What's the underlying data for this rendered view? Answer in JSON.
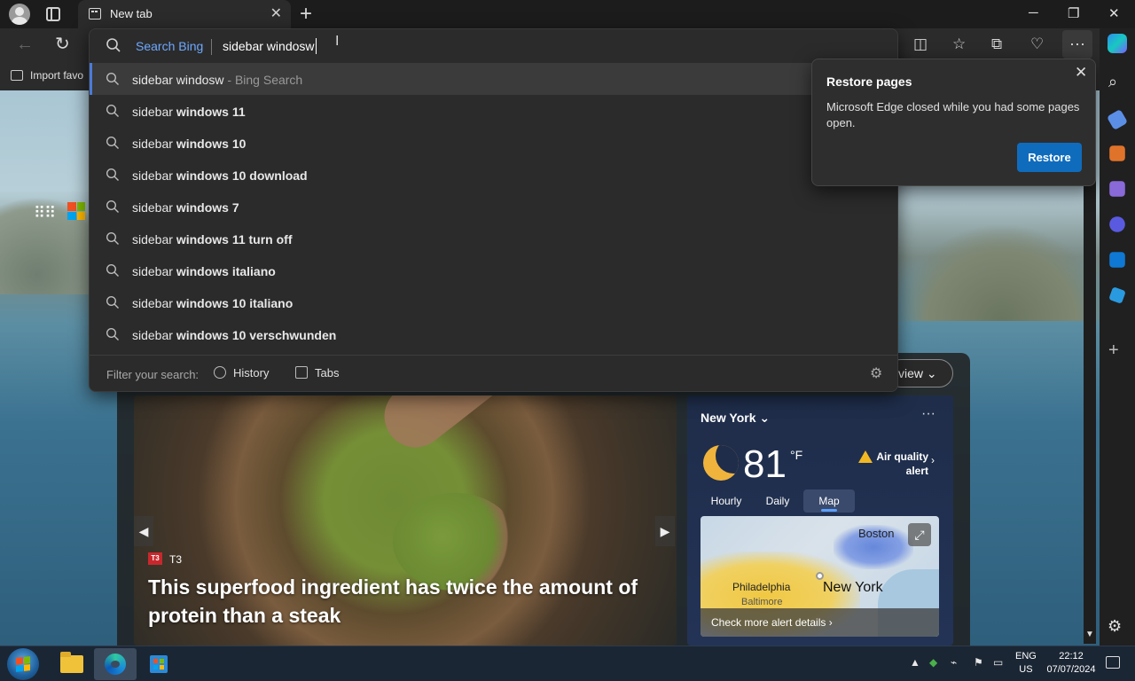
{
  "browser": {
    "tab_title": "New tab",
    "favorites": {
      "import_label": "Import favo"
    }
  },
  "omnibox": {
    "engine_label": "Search Bing",
    "query": "sidebar windosw",
    "suggestions": [
      {
        "prefix": "sidebar windosw",
        "bold": "",
        "hint": " - Bing Search"
      },
      {
        "prefix": "sidebar ",
        "bold": "windows 11",
        "hint": ""
      },
      {
        "prefix": "sidebar ",
        "bold": "windows 10",
        "hint": ""
      },
      {
        "prefix": "sidebar ",
        "bold": "windows 10 download",
        "hint": ""
      },
      {
        "prefix": "sidebar ",
        "bold": "windows 7",
        "hint": ""
      },
      {
        "prefix": "sidebar ",
        "bold": "windows 11 turn off",
        "hint": ""
      },
      {
        "prefix": "sidebar ",
        "bold": "windows italiano",
        "hint": ""
      },
      {
        "prefix": "sidebar ",
        "bold": "windows 10 italiano",
        "hint": ""
      },
      {
        "prefix": "sidebar ",
        "bold": "windows 10 verschwunden",
        "hint": ""
      }
    ],
    "filter": {
      "label": "Filter your search:",
      "history": "History",
      "tabs": "Tabs"
    }
  },
  "restore_popup": {
    "title": "Restore pages",
    "message": "Microsoft Edge closed while you had some pages open.",
    "button": "Restore"
  },
  "feed": {
    "view_button": "view",
    "article": {
      "source": "T3",
      "source_badge": "T3",
      "headline": "This superfood ingredient has twice the amount of protein than a steak"
    },
    "weather": {
      "city": "New York",
      "temperature": "81",
      "unit": "°F",
      "alert": "Air quality alert",
      "tabs": [
        "Hourly",
        "Daily",
        "Map"
      ],
      "active_tab": "Map",
      "map_labels": {
        "boston": "Boston",
        "philadelphia": "Philadelphia",
        "baltimore": "Baltimore",
        "new_york": "New York"
      },
      "map_footer": "Check more alert details"
    }
  },
  "taskbar": {
    "language": "ENG",
    "region": "US",
    "time": "22:12",
    "date": "07/07/2024"
  },
  "colors": {
    "accent": "#0f6cbd",
    "bing_blue": "#6ea8ff",
    "highlight_bar": "#4a7bd8"
  }
}
